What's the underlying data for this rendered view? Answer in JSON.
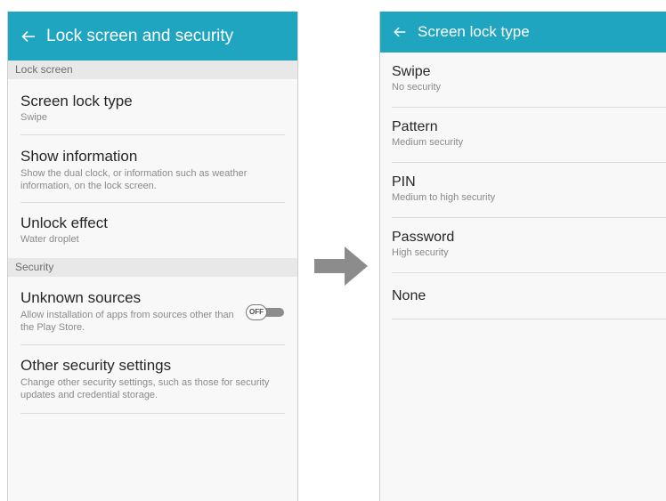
{
  "left": {
    "title": "Lock screen and security",
    "sections": {
      "lock_screen": "Lock screen",
      "security": "Security"
    },
    "items": [
      {
        "title": "Screen lock type",
        "subtitle": "Swipe"
      },
      {
        "title": "Show information",
        "subtitle": "Show the dual clock, or information such as weather information, on the lock screen."
      },
      {
        "title": "Unlock effect",
        "subtitle": "Water droplet"
      },
      {
        "title": "Unknown sources",
        "subtitle": "Allow installation of apps from sources other than the Play Store.",
        "toggle": "OFF"
      },
      {
        "title": "Other security settings",
        "subtitle": "Change other security settings, such as those for security updates and credential storage."
      }
    ]
  },
  "right": {
    "title": "Screen lock type",
    "items": [
      {
        "title": "Swipe",
        "subtitle": "No security"
      },
      {
        "title": "Pattern",
        "subtitle": "Medium security"
      },
      {
        "title": "PIN",
        "subtitle": "Medium to high security"
      },
      {
        "title": "Password",
        "subtitle": "High security"
      },
      {
        "title": "None"
      }
    ]
  },
  "icons": {
    "back": "back-arrow-icon",
    "transition": "right-arrow-icon",
    "toggle": "toggle-switch-off"
  },
  "colors": {
    "appbar": "#1fa5c0",
    "section_header_bg": "#e8e8e8",
    "transition_arrow": "#8c8c8c"
  }
}
